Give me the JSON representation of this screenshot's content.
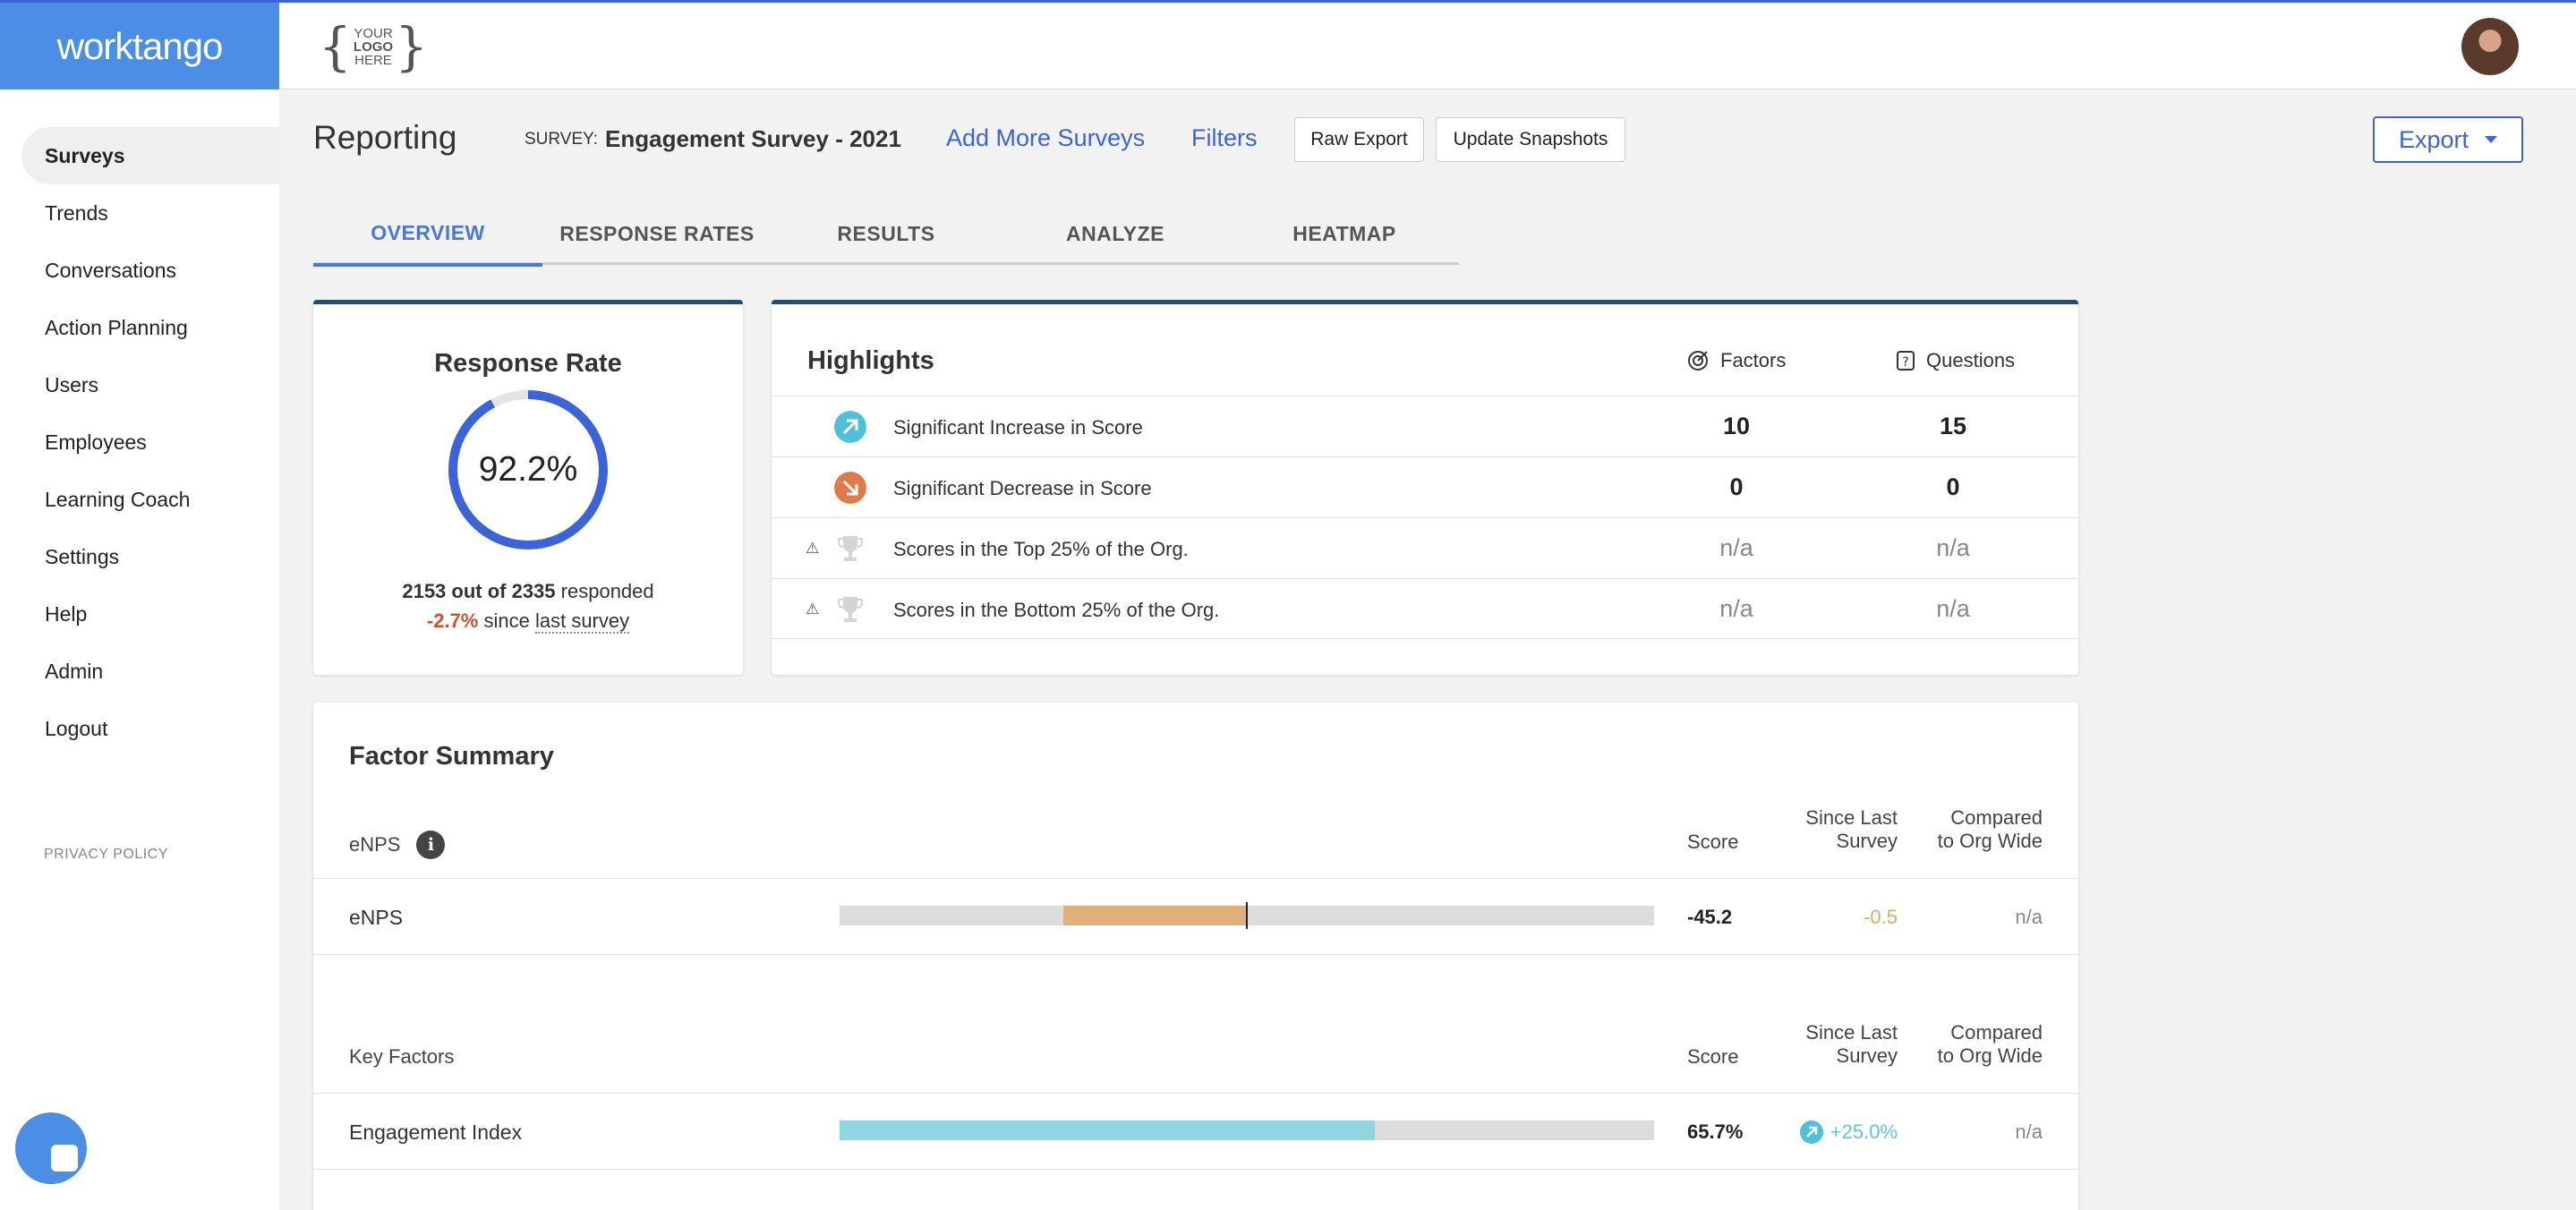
{
  "brand": "worktango",
  "header": {
    "logo_placeholder": [
      "YOUR",
      "LOGO",
      "HERE"
    ]
  },
  "sidebar": {
    "items": [
      {
        "label": "Surveys",
        "active": true
      },
      {
        "label": "Trends"
      },
      {
        "label": "Conversations"
      },
      {
        "label": "Action Planning"
      },
      {
        "label": "Users"
      },
      {
        "label": "Employees"
      },
      {
        "label": "Learning Coach"
      },
      {
        "label": "Settings"
      },
      {
        "label": "Help"
      },
      {
        "label": "Admin"
      },
      {
        "label": "Logout"
      }
    ],
    "privacy": "PRIVACY POLICY"
  },
  "page": {
    "title": "Reporting",
    "survey_label": "SURVEY:",
    "survey_name": "Engagement Survey - 2021",
    "add_surveys": "Add More Surveys",
    "filters": "Filters",
    "raw_export": "Raw Export",
    "update_snapshots": "Update Snapshots",
    "export": "Export"
  },
  "tabs": [
    "OVERVIEW",
    "RESPONSE RATES",
    "RESULTS",
    "ANALYZE",
    "HEATMAP"
  ],
  "response_rate": {
    "title": "Response Rate",
    "percent_label": "92.2%",
    "percent_value": 92.2,
    "responded": "2153 out of 2335",
    "responded_suffix": "responded",
    "change": "-2.7%",
    "since_prefix": "since",
    "since_link": "last survey",
    "ring_color": "#3a64d8"
  },
  "highlights": {
    "title": "Highlights",
    "col_factors": "Factors",
    "col_questions": "Questions",
    "rows": [
      {
        "label": "Significant Increase in Score",
        "factors": "10",
        "questions": "15",
        "icon": "arrow-up-right-icon",
        "color": "#4ec0d9"
      },
      {
        "label": "Significant Decrease in Score",
        "factors": "0",
        "questions": "0",
        "icon": "arrow-down-right-icon",
        "color": "#e07a4a"
      },
      {
        "label": "Scores in the Top 25% of the Org.",
        "factors": "n/a",
        "questions": "n/a",
        "icon": "trophy-icon"
      },
      {
        "label": "Scores in the Bottom 25% of the Org.",
        "factors": "n/a",
        "questions": "n/a",
        "icon": "trophy-icon"
      }
    ]
  },
  "factor_summary": {
    "title": "Factor Summary",
    "col_score": "Score",
    "col_since": [
      "Since Last",
      "Survey"
    ],
    "col_compared": [
      "Compared",
      "to Org Wide"
    ],
    "enps_section": "eNPS",
    "key_section": "Key Factors",
    "enps_row": {
      "name": "eNPS",
      "score": "-45.2",
      "since": "-0.5",
      "compared": "n/a",
      "color": "#e0b07a",
      "since_color": "#e0a860"
    },
    "key_rows": [
      {
        "name": "Engagement Index",
        "score": "65.7%",
        "value": 65.7,
        "since": "+25.0%",
        "compared": "n/a",
        "color": "#8fd6e0",
        "since_color": "#5ec6d9"
      }
    ]
  }
}
